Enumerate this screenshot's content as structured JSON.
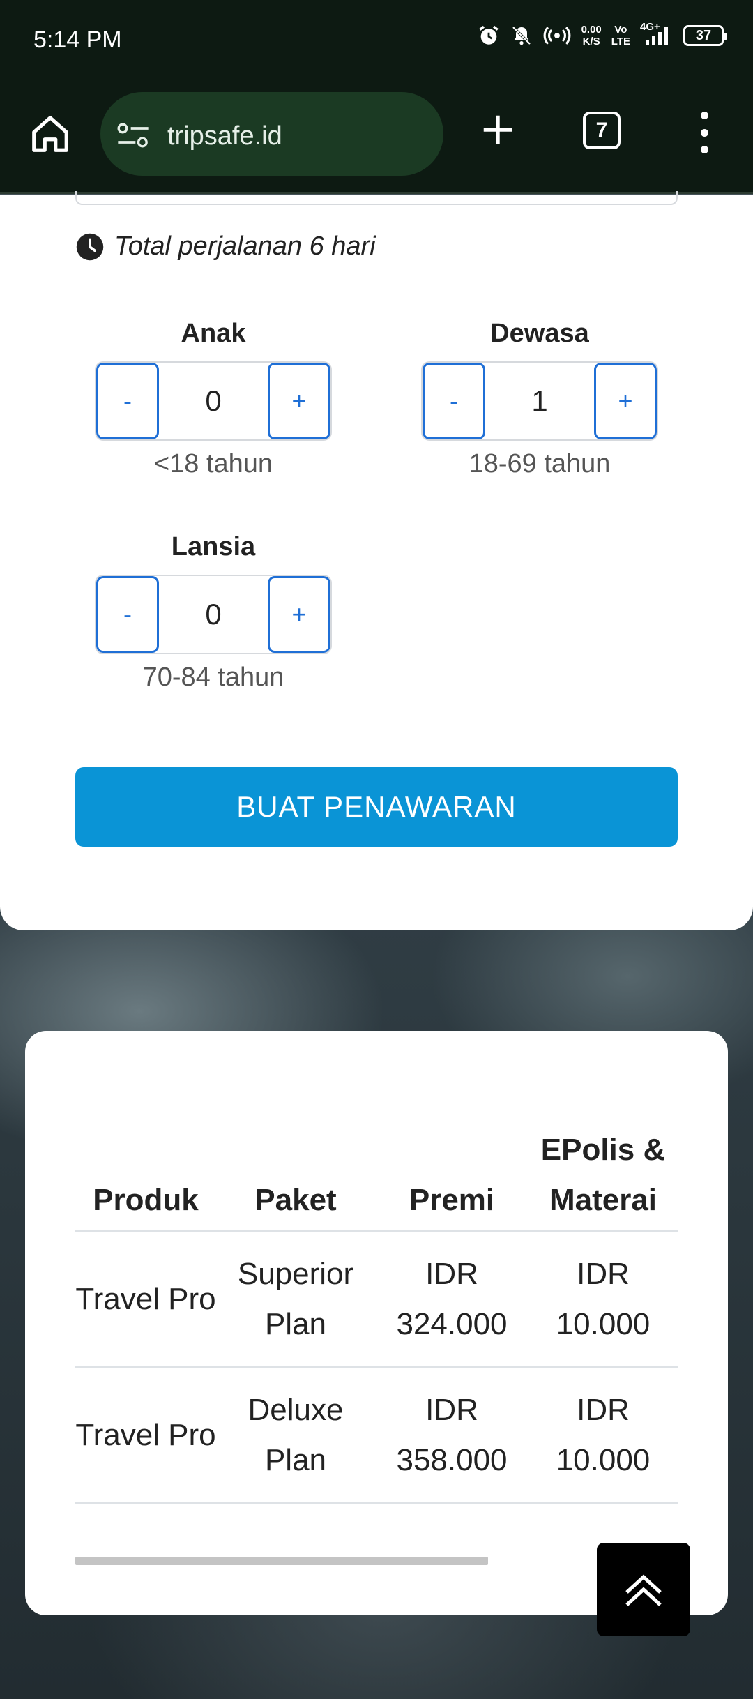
{
  "status_bar": {
    "time": "5:14 PM",
    "net_speed_value": "0.00",
    "net_speed_unit": "K/S",
    "volte_top": "Vo",
    "volte_bottom": "LTE",
    "network": "4G+",
    "battery": "37"
  },
  "browser": {
    "url": "tripsafe.id",
    "tab_count": "7"
  },
  "form": {
    "total_trip": "Total perjalanan 6 hari",
    "steppers": [
      {
        "label": "Anak",
        "value": "0",
        "hint": "<18 tahun",
        "minus": "-",
        "plus": "+"
      },
      {
        "label": "Dewasa",
        "value": "1",
        "hint": "18-69 tahun",
        "minus": "-",
        "plus": "+"
      },
      {
        "label": "Lansia",
        "value": "0",
        "hint": "70-84 tahun",
        "minus": "-",
        "plus": "+"
      }
    ],
    "submit_label": "BUAT PENAWARAN"
  },
  "table": {
    "headers": [
      "Produk",
      "Paket",
      "Premi",
      "EPolis & Materai"
    ],
    "rows": [
      [
        "Travel Pro",
        "Superior Plan",
        "IDR 324.000",
        "IDR 10.000"
      ],
      [
        "Travel Pro",
        "Deluxe Plan",
        "IDR 358.000",
        "IDR 10.000"
      ]
    ]
  },
  "colors": {
    "accent": "#0a94d6",
    "stepper_blue": "#1f6fd6",
    "browser_bar": "#0d1a12"
  },
  "icons": {
    "clock": "clock-icon",
    "home": "home-icon",
    "site_settings": "tune-icon",
    "new_tab": "plus-icon",
    "menu": "more-vert-icon",
    "scroll_top": "double-chevron-up-icon"
  }
}
